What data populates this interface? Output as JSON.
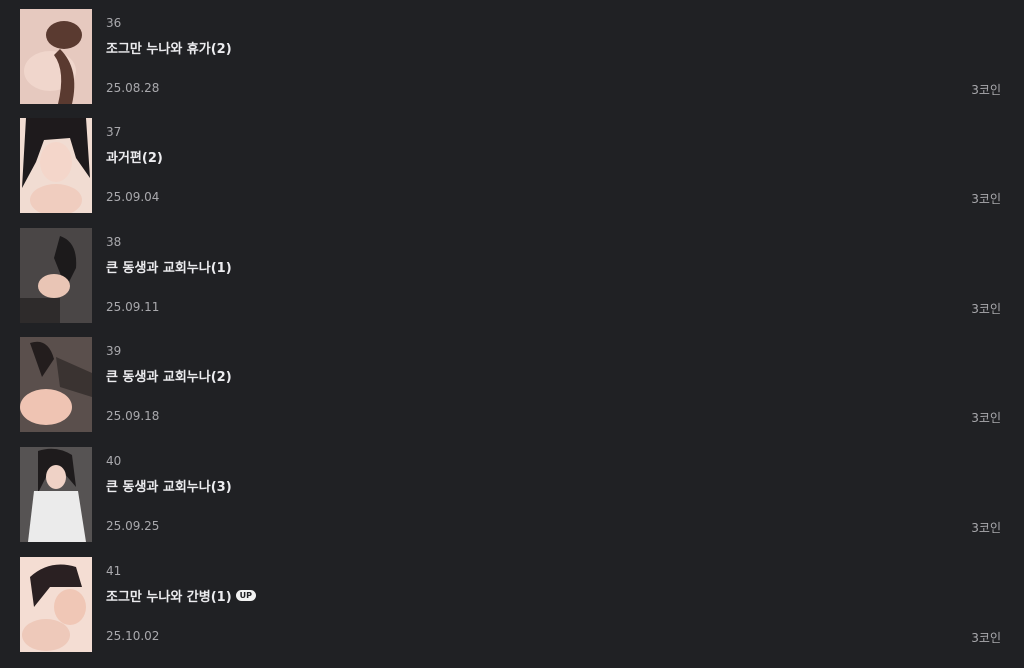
{
  "episodes": [
    {
      "number": "36",
      "title": "조그만 누나와 휴가(2)",
      "date": "25.08.28",
      "price": "3코인",
      "thumb_tone": "#e6c9bf",
      "thumb_accent": "#5a3a30"
    },
    {
      "number": "37",
      "title": "과거편(2)",
      "date": "25.09.04",
      "price": "3코인",
      "thumb_tone": "#f1dcd2",
      "thumb_accent": "#1e1a1c"
    },
    {
      "number": "38",
      "title": "큰 동생과 교회누나(1)",
      "date": "25.09.11",
      "price": "3코인",
      "thumb_tone": "#4a4646",
      "thumb_accent": "#e9c5b5"
    },
    {
      "number": "39",
      "title": "큰 동생과 교회누나(2)",
      "date": "25.09.18",
      "price": "3코인",
      "thumb_tone": "#5a4f4c",
      "thumb_accent": "#efc4b3"
    },
    {
      "number": "40",
      "title": "큰 동생과 교회누나(3)",
      "date": "25.09.25",
      "price": "3코인",
      "thumb_tone": "#565353",
      "thumb_accent": "#ebebeb"
    },
    {
      "number": "41",
      "title": "조그만 누나와 간병(1)",
      "date": "25.10.02",
      "price": "3코인",
      "thumb_tone": "#f4ddd3",
      "thumb_accent": "#2a2022",
      "badge": "UP"
    }
  ]
}
